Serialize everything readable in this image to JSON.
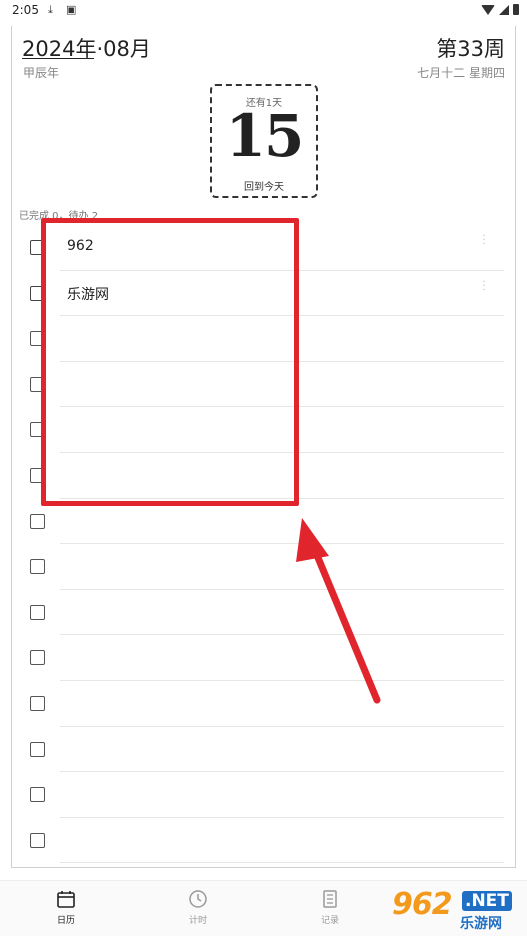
{
  "status_bar": {
    "time": "2:05"
  },
  "header": {
    "year_month": "2024年·08月",
    "ganzhi": "甲辰年",
    "week_number": "第33周",
    "lunar_weekday": "七月十二  星期四"
  },
  "day_card": {
    "remaining": "还有1天",
    "day": "15",
    "back_today": "回到今天"
  },
  "summary": "已完成 0，待办 2",
  "todos": [
    {
      "text": "962",
      "checked": false
    },
    {
      "text": "乐游网",
      "checked": false
    },
    {
      "text": "",
      "checked": false
    },
    {
      "text": "",
      "checked": false
    },
    {
      "text": "",
      "checked": false
    },
    {
      "text": "",
      "checked": false
    },
    {
      "text": "",
      "checked": false
    },
    {
      "text": "",
      "checked": false
    },
    {
      "text": "",
      "checked": false
    },
    {
      "text": "",
      "checked": false
    },
    {
      "text": "",
      "checked": false
    },
    {
      "text": "",
      "checked": false
    },
    {
      "text": "",
      "checked": false
    },
    {
      "text": "",
      "checked": false
    }
  ],
  "bottom_nav": [
    {
      "label": "日历",
      "icon": "calendar-icon",
      "active": true
    },
    {
      "label": "计时",
      "icon": "clock-icon",
      "active": false
    },
    {
      "label": "记录",
      "icon": "notebook-icon",
      "active": false
    }
  ],
  "watermark": {
    "number": "962",
    "suffix": ".NET",
    "site": "乐游网"
  },
  "colors": {
    "annotation": "#e0252d",
    "watermark_orange": "#f39a1c",
    "watermark_blue": "#1f6fc4"
  }
}
